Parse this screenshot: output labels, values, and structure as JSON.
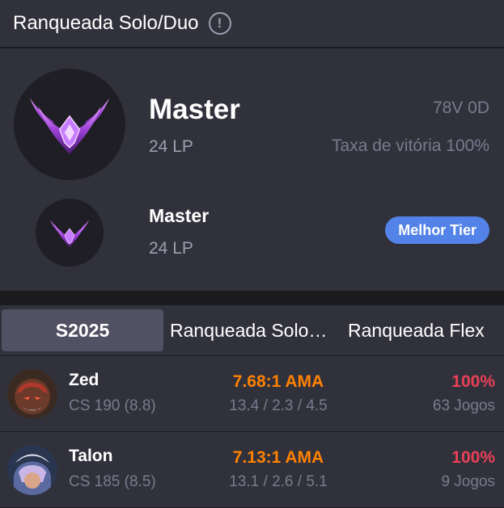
{
  "header": {
    "title": "Ranqueada Solo/Duo",
    "info_glyph": "!"
  },
  "current_rank": {
    "tier": "Master",
    "lp": "24 LP",
    "record": "78V 0D",
    "win_rate": "Taxa de vitória 100%"
  },
  "best_rank": {
    "tier": "Master",
    "lp": "24 LP",
    "badge": "Melhor Tier"
  },
  "tabs": [
    {
      "label": "S2025",
      "active": true
    },
    {
      "label": "Ranqueada Solo/Duo",
      "active": false
    },
    {
      "label": "Ranqueada Flex",
      "active": false
    }
  ],
  "champions": [
    {
      "name": "Zed",
      "cs": "CS 190 (8.8)",
      "kda_ratio": "7.68:1 AMA",
      "kda": "13.4 / 2.3 / 4.5",
      "win_pct": "100%",
      "games": "63 Jogos"
    },
    {
      "name": "Talon",
      "cs": "CS 185 (8.5)",
      "kda_ratio": "7.13:1 AMA",
      "kda": "13.1 / 2.6 / 5.1",
      "win_pct": "100%",
      "games": "9 Jogos"
    }
  ],
  "colors": {
    "background": "#31313c",
    "accent_blue": "#5383e8",
    "kda_orange": "#ff8200",
    "win_red": "#e84057",
    "muted_text": "#7b7a8e"
  },
  "icons": [
    "info-icon",
    "master-emblem-icon",
    "zed-portrait",
    "talon-portrait"
  ]
}
